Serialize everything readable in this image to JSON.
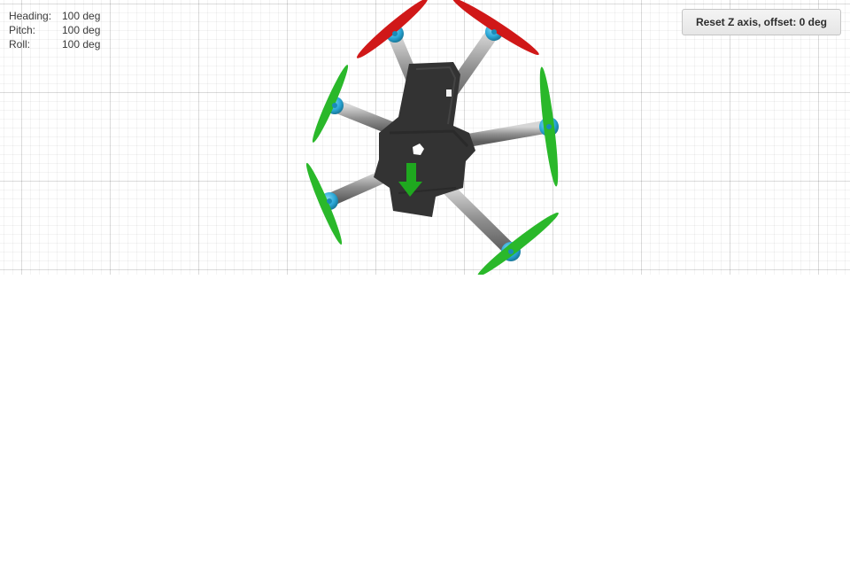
{
  "attitude": {
    "heading_label": "Heading:",
    "heading_value": "100 deg",
    "pitch_label": "Pitch:",
    "pitch_value": "100 deg",
    "roll_label": "Roll:",
    "roll_value": "100 deg"
  },
  "reset_button": {
    "label": "Reset Z axis, offset: 0 deg"
  },
  "model": {
    "type": "hexacopter",
    "front_prop_color": "#d01818",
    "rear_prop_color": "#2ab82a",
    "frame_color": "#333333",
    "arm_color": "#9a9a9a",
    "motor_color": "#2aa6d6",
    "direction_arrow_color": "#1fa81f",
    "icons": [
      "heading-arrow-icon"
    ]
  }
}
